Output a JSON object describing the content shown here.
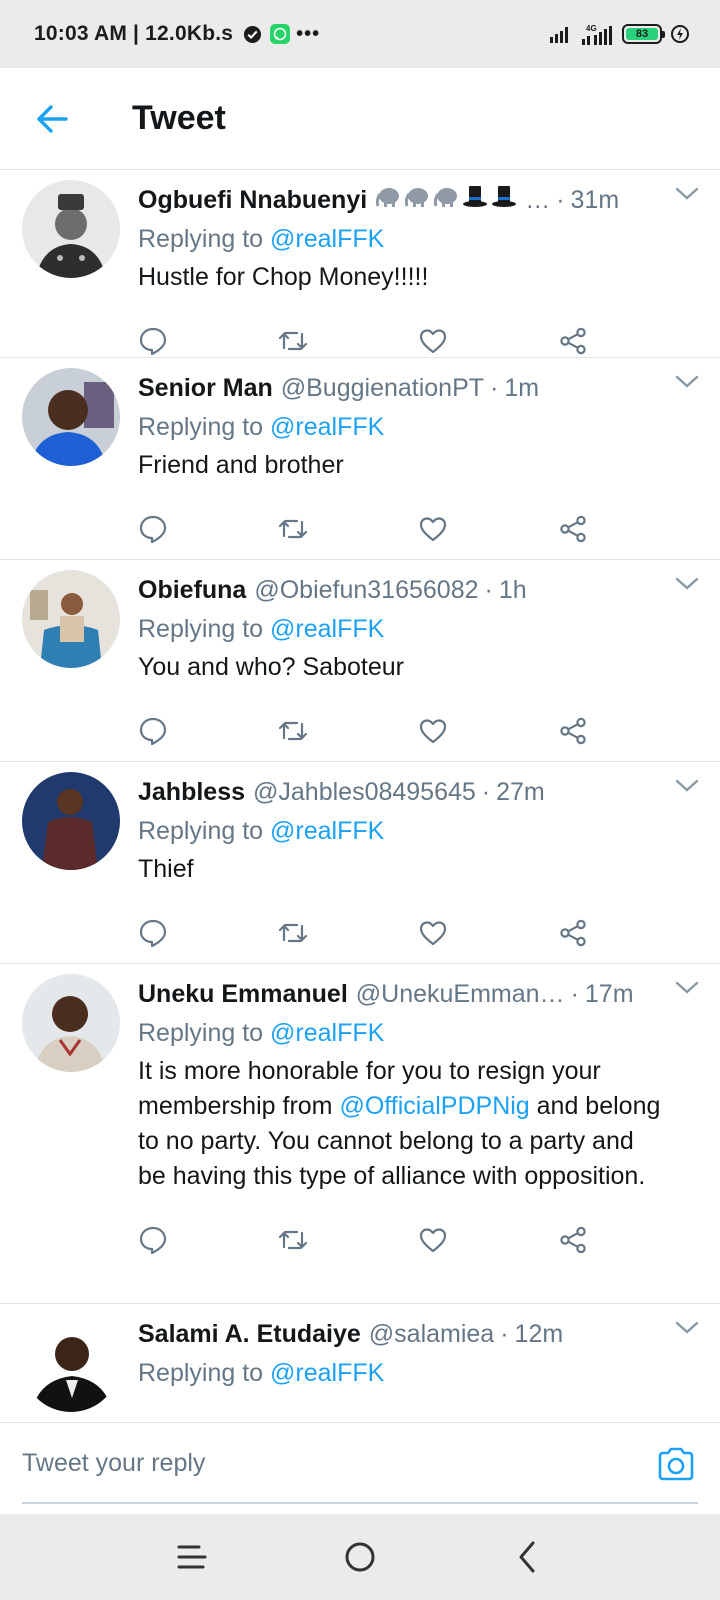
{
  "status_bar": {
    "time": "10:03 AM | 12.0Kb.s",
    "more": "•••",
    "battery_level": "83"
  },
  "header": {
    "title": "Tweet"
  },
  "tweets": [
    {
      "name": "Ogbuefi Nnabuenyi",
      "handle": "",
      "emojis": "🐘🐘🐘🎩🎩",
      "ellipsis": "…",
      "dot": "·",
      "time": "31m",
      "replying_prefix": "Replying to ",
      "replying_to": "@realFFK",
      "body": "Hustle for Chop Money!!!!!"
    },
    {
      "name": "Senior Man",
      "handle": "@BuggienationPT",
      "dot": "·",
      "time": "1m",
      "replying_prefix": "Replying to ",
      "replying_to": "@realFFK",
      "body": "Friend and brother"
    },
    {
      "name": "Obiefuna",
      "handle": "@Obiefun31656082",
      "dot": "·",
      "time": "1h",
      "replying_prefix": "Replying to ",
      "replying_to": "@realFFK",
      "body": "You and who? Saboteur"
    },
    {
      "name": "Jahbless",
      "handle": "@Jahbles08495645",
      "dot": "·",
      "time": "27m",
      "replying_prefix": "Replying to ",
      "replying_to": "@realFFK",
      "body": "Thief"
    },
    {
      "name": "Uneku Emmanuel",
      "handle": "@UnekuEmman…",
      "dot": "·",
      "time": "17m",
      "replying_prefix": "Replying to ",
      "replying_to": "@realFFK",
      "body_part1": "It is more honorable for you to resign your membership from ",
      "body_mention": "@OfficialPDPNig",
      "body_part2": " and belong to no party. You cannot belong to a party and be having this type of alliance with opposition."
    },
    {
      "name": "Salami A. Etudaiye",
      "handle": "@salamiea",
      "dot": "·",
      "time": "12m",
      "replying_prefix": "Replying to ",
      "replying_to": "@realFFK"
    }
  ],
  "reply_bar": {
    "placeholder": "Tweet your reply"
  },
  "colors": {
    "accent": "#1da1f2",
    "secondary_text": "#657786",
    "battery_fill": "#2ad17b"
  },
  "icons": {
    "back": "arrow-left-icon",
    "caret": "chevron-down-icon",
    "reply": "comment-icon",
    "retweet": "retweet-icon",
    "like": "heart-icon",
    "share": "share-icon",
    "camera": "camera-icon"
  }
}
